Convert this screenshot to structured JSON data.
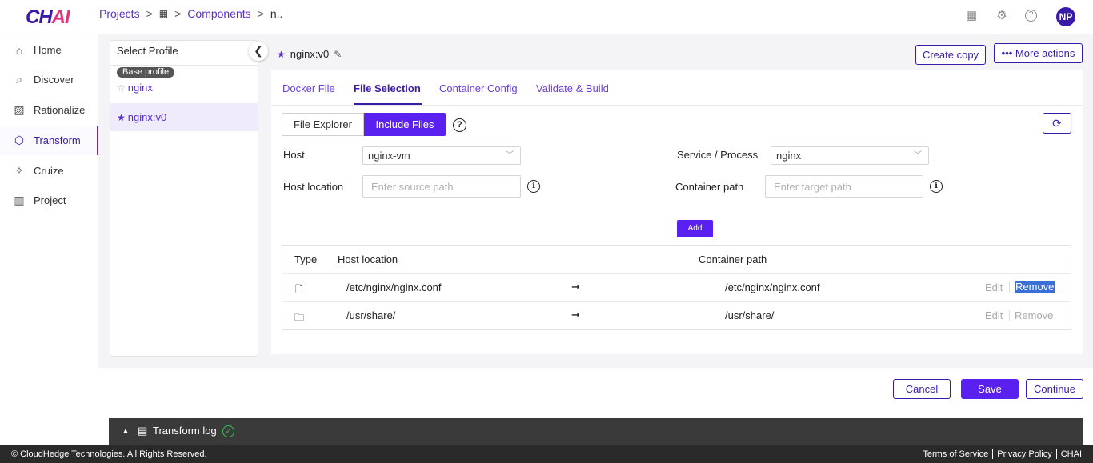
{
  "app": {
    "logo_main": "CH",
    "logo_accent": "AI"
  },
  "breadcrumb": {
    "projects": "Projects",
    "components": "Components",
    "current": "n.."
  },
  "user": {
    "initials": "NP"
  },
  "sidebar": {
    "items": [
      {
        "label": "Home",
        "icon": "home-icon"
      },
      {
        "label": "Discover",
        "icon": "discover-icon"
      },
      {
        "label": "Rationalize",
        "icon": "rationalize-icon"
      },
      {
        "label": "Transform",
        "icon": "transform-icon",
        "active": true
      },
      {
        "label": "Cruize",
        "icon": "cruize-icon"
      },
      {
        "label": "Project",
        "icon": "project-icon"
      }
    ]
  },
  "profiles": {
    "title": "Select Profile",
    "base_badge": "Base profile",
    "items": [
      {
        "name": "nginx",
        "starred": false
      },
      {
        "name": "nginx:v0",
        "starred": true,
        "selected": true
      }
    ]
  },
  "content": {
    "title": "nginx:v0",
    "create_copy": "Create copy",
    "more_actions": "More actions",
    "tabs": [
      {
        "label": "Docker File"
      },
      {
        "label": "File Selection",
        "active": true
      },
      {
        "label": "Container Config"
      },
      {
        "label": "Validate & Build"
      }
    ],
    "segment": {
      "explorer": "File Explorer",
      "include": "Include Files"
    },
    "form": {
      "host_label": "Host",
      "host_value": "nginx-vm",
      "service_label": "Service / Process",
      "service_value": "nginx",
      "host_location_label": "Host location",
      "host_location_placeholder": "Enter source path",
      "container_path_label": "Container path",
      "container_path_placeholder": "Enter target path",
      "add": "Add"
    },
    "table": {
      "headers": {
        "type": "Type",
        "host_location": "Host location",
        "container_path": "Container path"
      },
      "rows": [
        {
          "type": "file",
          "host": "/etc/nginx/nginx.conf",
          "container": "/etc/nginx/nginx.conf",
          "edit": "Edit",
          "remove": "Remove"
        },
        {
          "type": "folder",
          "host": "/usr/share/",
          "container": "/usr/share/",
          "edit": "Edit",
          "remove": "Remove"
        }
      ]
    }
  },
  "actions": {
    "cancel": "Cancel",
    "save": "Save",
    "continue": "Continue"
  },
  "log": {
    "label": "Transform log"
  },
  "footer": {
    "copyright": "© CloudHedge Technologies. All Rights Reserved.",
    "terms": "Terms of Service",
    "privacy": "Privacy Policy",
    "brand": "CHAI"
  },
  "colors": {
    "primary": "#5a20f0",
    "brand_dark": "#3a1aa8",
    "accent": "#e0337a"
  }
}
